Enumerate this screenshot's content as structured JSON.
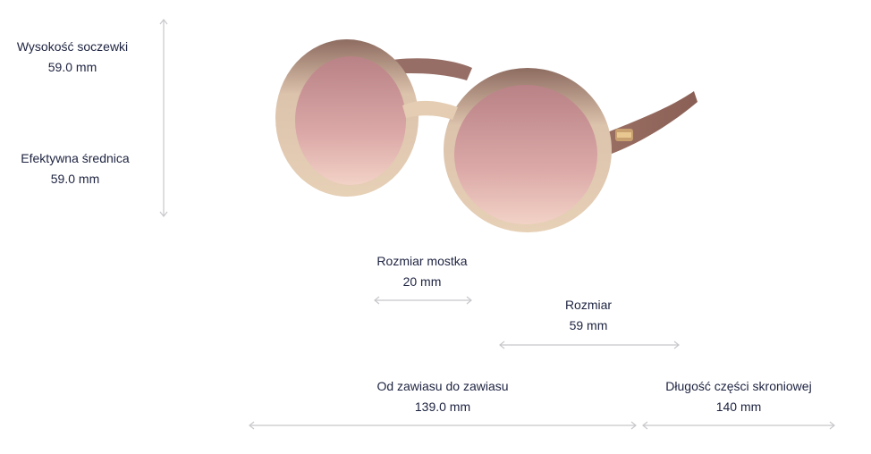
{
  "measurements": {
    "lens_height": {
      "label": "Wysokość soczewki",
      "value": "59.0 mm"
    },
    "effective_diameter": {
      "label": "Efektywna średnica",
      "value": "59.0 mm"
    },
    "bridge_size": {
      "label": "Rozmiar mostka",
      "value": "20 mm"
    },
    "lens_size": {
      "label": "Rozmiar",
      "value": "59 mm"
    },
    "hinge_to_hinge": {
      "label": "Od zawiasu do zawiasu",
      "value": "139.0 mm"
    },
    "temple_length": {
      "label": "Długość części skroniowej",
      "value": "140 mm"
    }
  },
  "product_image": {
    "icon": "sunglasses-image"
  },
  "colors": {
    "text": "#1d2340",
    "arrow": "#c8c8cc",
    "frame": "#a98a7a",
    "lens": "#d7a7aa"
  }
}
